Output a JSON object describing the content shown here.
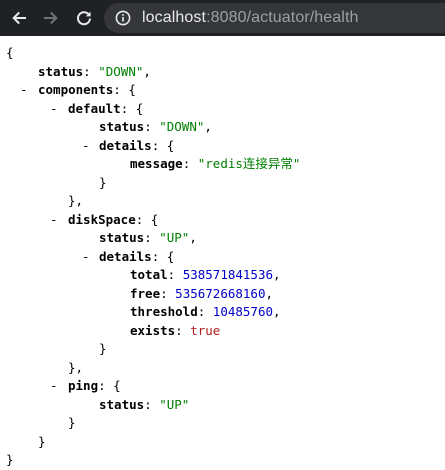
{
  "browser": {
    "url_host": "localhost",
    "url_rest": ":8080/actuator/health",
    "back_icon": "arrow-left-icon",
    "forward_icon": "arrow-right-icon",
    "reload_icon": "reload-icon",
    "info_icon": "info-icon"
  },
  "json_viewer": {
    "open_brace": "{",
    "close_brace": "}",
    "toggle_glyph": "-",
    "status_key": "status",
    "status_value": "\"DOWN\"",
    "components_key": "components",
    "default": {
      "key": "default",
      "status_key": "status",
      "status_value": "\"DOWN\"",
      "details_key": "details",
      "message_key": "message",
      "message_value": "\"redis连接异常\""
    },
    "diskSpace": {
      "key": "diskSpace",
      "status_key": "status",
      "status_value": "\"UP\"",
      "details_key": "details",
      "total_key": "total",
      "total_value": "538571841536",
      "free_key": "free",
      "free_value": "535672668160",
      "threshold_key": "threshold",
      "threshold_value": "10485760",
      "exists_key": "exists",
      "exists_value": "true"
    },
    "ping": {
      "key": "ping",
      "status_key": "status",
      "status_value": "\"UP\""
    }
  },
  "colors": {
    "toolbar_bg": "#202124",
    "omnibox_bg": "#35363a",
    "string": "#008000",
    "number": "#0000cc",
    "boolean": "#b22222"
  }
}
